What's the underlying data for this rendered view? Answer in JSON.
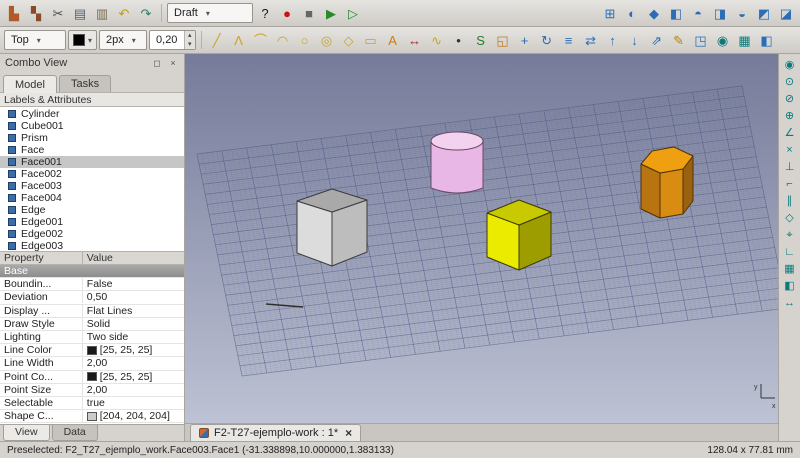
{
  "ui": {
    "combo_arrow": "▾",
    "spin_up": "▴",
    "spin_down": "▾",
    "dock_float": "◻",
    "dock_close": "×",
    "tab_close": "×"
  },
  "toolbar1": {
    "workbench_combo": "Draft",
    "left_icons": [
      {
        "name": "arch-icon",
        "glyph": "▙",
        "color": "#b2592a"
      },
      {
        "name": "structure-icon",
        "glyph": "▚",
        "color": "#8a4a2a"
      },
      {
        "name": "cut-icon",
        "glyph": "✂",
        "color": "#4a4a4a"
      },
      {
        "name": "copy-icon",
        "glyph": "▤",
        "color": "#55617a"
      },
      {
        "name": "paste-icon",
        "glyph": "▥",
        "color": "#7a6a4a"
      },
      {
        "name": "undo-icon",
        "glyph": "↶",
        "color": "#c8960c"
      },
      {
        "name": "redo-icon",
        "glyph": "↷",
        "color": "#2e7d6e"
      }
    ],
    "mid_icons": [
      {
        "name": "whats-this-icon",
        "glyph": "?",
        "color": "#1a1a1a"
      },
      {
        "name": "macro-record-icon",
        "glyph": "●",
        "color": "#cc1111"
      },
      {
        "name": "macro-stop-icon",
        "glyph": "■",
        "color": "#666666"
      },
      {
        "name": "macro-play-icon",
        "glyph": "▶",
        "color": "#2a8a2a"
      },
      {
        "name": "macro-debug-icon",
        "glyph": "▷",
        "color": "#2a8a2a"
      }
    ],
    "view_icons": [
      {
        "name": "fit-all-icon",
        "glyph": "⊞",
        "color": "#2d6db5"
      },
      {
        "name": "draw-style-icon",
        "glyph": "◐",
        "color": "#2d6db5"
      },
      {
        "name": "view-isometric-icon",
        "glyph": "◆",
        "color": "#2d6db5"
      },
      {
        "name": "view-front-icon",
        "glyph": "◧",
        "color": "#2d6db5"
      },
      {
        "name": "view-top-icon",
        "glyph": "◓",
        "color": "#2d6db5"
      },
      {
        "name": "view-right-icon",
        "glyph": "◨",
        "color": "#2d6db5"
      },
      {
        "name": "view-rear-icon",
        "glyph": "◒",
        "color": "#2d6db5"
      },
      {
        "name": "view-bottom-icon",
        "glyph": "◩",
        "color": "#2d6db5"
      },
      {
        "name": "view-left-icon",
        "glyph": "◪",
        "color": "#2d6db5"
      }
    ]
  },
  "toolbar2": {
    "view_combo": "Top",
    "line_color": "#000000",
    "line_width_combo": "2px",
    "scale_value": "0,20",
    "icons": [
      {
        "name": "draft-line-icon",
        "glyph": "╱",
        "color": "#c9a227"
      },
      {
        "name": "draft-polyline-icon",
        "glyph": "Λ",
        "color": "#c9a227"
      },
      {
        "name": "draft-fillet-icon",
        "glyph": "⌒",
        "color": "#c9a227"
      },
      {
        "name": "draft-arc-icon",
        "glyph": "◠",
        "color": "#c9a227"
      },
      {
        "name": "draft-circle-icon",
        "glyph": "○",
        "color": "#c9a227"
      },
      {
        "name": "draft-ellipse-icon",
        "glyph": "◎",
        "color": "#c9a227"
      },
      {
        "name": "draft-polygon-icon",
        "glyph": "◇",
        "color": "#c9a227"
      },
      {
        "name": "draft-rectangle-icon",
        "glyph": "▭",
        "color": "#c9a227"
      },
      {
        "name": "draft-text-icon",
        "glyph": "A",
        "color": "#cc7a1a"
      },
      {
        "name": "draft-dimension-icon",
        "glyph": "↔",
        "color": "#b22222"
      },
      {
        "name": "draft-bspline-icon",
        "glyph": "∿",
        "color": "#c9a227"
      },
      {
        "name": "draft-point-icon",
        "glyph": "•",
        "color": "#333333"
      },
      {
        "name": "draft-shapestring-icon",
        "glyph": "S",
        "color": "#2a7a2a"
      },
      {
        "name": "draft-facebinder-icon",
        "glyph": "◱",
        "color": "#c07820"
      },
      {
        "name": "draft-move-icon",
        "glyph": "+",
        "color": "#2d6db5"
      },
      {
        "name": "draft-rotate-icon",
        "glyph": "↻",
        "color": "#2d6db5"
      },
      {
        "name": "draft-offset-icon",
        "glyph": "≡",
        "color": "#2d6db5"
      },
      {
        "name": "draft-trimex-icon",
        "glyph": "⇄",
        "color": "#2d6db5"
      },
      {
        "name": "draft-upgrade-icon",
        "glyph": "↑",
        "color": "#2d6db5"
      },
      {
        "name": "draft-downgrade-icon",
        "glyph": "↓",
        "color": "#2d6db5"
      },
      {
        "name": "draft-scale-icon",
        "glyph": "⇗",
        "color": "#2d6db5"
      },
      {
        "name": "draft-edit-icon",
        "glyph": "✎",
        "color": "#b8860b"
      },
      {
        "name": "draft-wp-proxy-icon",
        "glyph": "◳",
        "color": "#2d6db5"
      },
      {
        "name": "draft-snap-lock-icon",
        "glyph": "◉",
        "color": "#0a7a7a"
      },
      {
        "name": "draft-grid-toggle-icon",
        "glyph": "▦",
        "color": "#0a7a7a"
      },
      {
        "name": "draft-working-plane-icon",
        "glyph": "◧",
        "color": "#2d6db5"
      }
    ]
  },
  "combo_view": {
    "title": "Combo View",
    "tabs": [
      {
        "label": "Model",
        "active": true
      },
      {
        "label": "Tasks"
      }
    ],
    "tree_header": "Labels & Attributes",
    "tree_items": [
      {
        "label": "Cylinder"
      },
      {
        "label": "Cube001"
      },
      {
        "label": "Prism"
      },
      {
        "label": "Face"
      },
      {
        "label": "Face001",
        "selected": true
      },
      {
        "label": "Face002"
      },
      {
        "label": "Face003"
      },
      {
        "label": "Face004"
      },
      {
        "label": "Edge"
      },
      {
        "label": "Edge001"
      },
      {
        "label": "Edge002"
      },
      {
        "label": "Edge003",
        "bold": true
      }
    ],
    "property_col1": "Property",
    "property_col2": "Value",
    "properties": [
      {
        "name": "Base",
        "value": "",
        "group": true
      },
      {
        "name": "Boundin...",
        "value": "False"
      },
      {
        "name": "Deviation",
        "value": "0,50"
      },
      {
        "name": "Display ...",
        "value": "Flat Lines"
      },
      {
        "name": "Draw Style",
        "value": "Solid"
      },
      {
        "name": "Lighting",
        "value": "Two side"
      },
      {
        "name": "Line Color",
        "value": "[25, 25, 25]",
        "swatch": "#191919"
      },
      {
        "name": "Line Width",
        "value": "2,00"
      },
      {
        "name": "Point Co...",
        "value": "[25, 25, 25]",
        "swatch": "#191919"
      },
      {
        "name": "Point Size",
        "value": "2,00"
      },
      {
        "name": "Selectable",
        "value": "true"
      },
      {
        "name": "Shape C...",
        "value": "[204, 204, 204]",
        "swatch": "#cccccc"
      }
    ],
    "bottom_tabs": [
      {
        "label": "View",
        "active": true
      },
      {
        "label": "Data"
      }
    ]
  },
  "right_toolbar": {
    "color": "#0a7a7a",
    "icons": [
      {
        "name": "snap-lock-icon",
        "glyph": "◉"
      },
      {
        "name": "snap-endpoint-icon",
        "glyph": "⊙"
      },
      {
        "name": "snap-midpoint-icon",
        "glyph": "⊘"
      },
      {
        "name": "snap-center-icon",
        "glyph": "⊕"
      },
      {
        "name": "snap-angle-icon",
        "glyph": "∠"
      },
      {
        "name": "snap-intersection-icon",
        "glyph": "×"
      },
      {
        "name": "snap-perpendicular-icon",
        "glyph": "⊥"
      },
      {
        "name": "snap-extension-icon",
        "glyph": "⌐"
      },
      {
        "name": "snap-parallel-icon",
        "glyph": "∥"
      },
      {
        "name": "snap-special-icon",
        "glyph": "◇"
      },
      {
        "name": "snap-near-icon",
        "glyph": "⌖"
      },
      {
        "name": "snap-ortho-icon",
        "glyph": "∟"
      },
      {
        "name": "snap-grid-icon",
        "glyph": "▦"
      },
      {
        "name": "snap-working-plane-icon",
        "glyph": "◧"
      },
      {
        "name": "snap-dimensions-icon",
        "glyph": "↔"
      }
    ]
  },
  "viewport": {
    "doc_tab_label": "F2-T27-ejemplo-work : 1*"
  },
  "scene": {
    "background_top": "#757b99",
    "background_bottom": "#bdc2d4",
    "grid_color": "#4a5480",
    "preselected_edge_color": "#2f2f2f",
    "axis_x": "x",
    "axis_y": "y",
    "shapes": {
      "gray_box": {
        "top": "#a9a9a9",
        "left": "#dcdcdc",
        "right": "#bdbdbd",
        "edge": "#3c3c3c"
      },
      "cylinder": {
        "top": "#f3d2f0",
        "side": "#e9b7e6",
        "edge": "#6a4a66"
      },
      "yellow_cube": {
        "top": "#c9c900",
        "front": "#ebeb00",
        "right": "#9d9d00",
        "edge": "#3a3a00"
      },
      "hex_prism": {
        "top": "#efa011",
        "left": "#b87410",
        "mid": "#d88d12",
        "right": "#9a6210",
        "edge": "#4f3408"
      }
    }
  },
  "statusbar": {
    "message": "Preselected: F2_T27_ejemplo_work.Face003.Face1 (-31.338898,10.000000,1.383133)",
    "dimensions": "128.04 x 77.81 mm"
  }
}
